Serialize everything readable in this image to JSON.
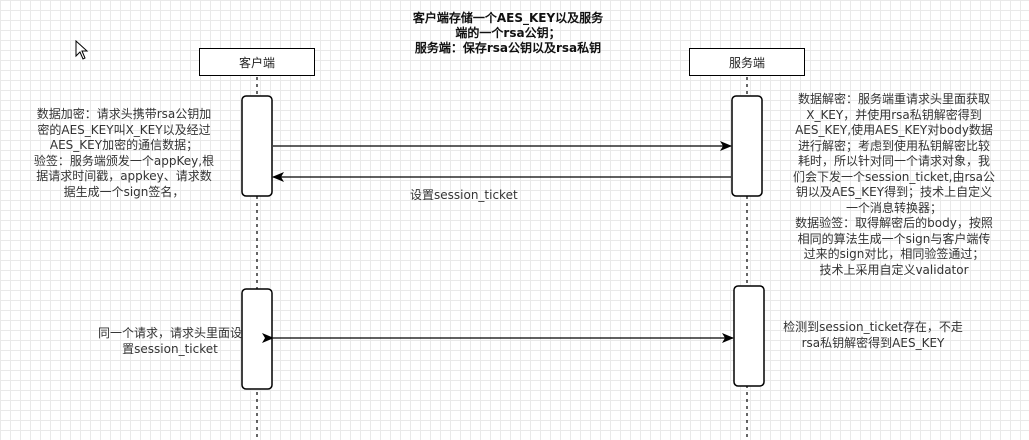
{
  "diagram": {
    "title": "客户端存储一个AES_KEY以及服务端的一个rsa公钥；\n服务端：保存rsa公钥以及rsa私钥",
    "participants": {
      "client": "客户端",
      "server": "服务端"
    },
    "notes": {
      "client_first": "数据加密：请求头携带rsa公钥加\n密的AES_KEY叫X_KEY以及经过\nAES_KEY加密的通信数据；\n验签：服务端颁发一个appKey,根\n据请求时间戳，appkey、请求数\n据生成一个sign签名，",
      "server_first": "数据解密：服务端重请求头里面获取\nX_KEY，并使用rsa私钥解密得到\nAES_KEY,使用AES_KEY对body数据\n进行解密；考虑到使用私钥解密比较\n耗时，所以针对同一个请求对象，我\n们会下发一个session_ticket,由rsa公\n钥以及AES_KEY得到；技术上自定义\n一个消息转换器；\n数据验签：取得解密后的body，按照\n相同的算法生成一个sign与客户端传\n过来的sign对比，相同验签通过；\n技术上采用自定义validator",
      "client_second": "同一个请求，请求头里面设\n置session_ticket",
      "server_second": "检测到session_ticket存在，不走\nrsa私钥解密得到AES_KEY"
    },
    "messages": {
      "return_label": "设置session_ticket"
    },
    "colors": {
      "line": "#000000",
      "text": "#333333",
      "grid": "#e9e9e9"
    }
  }
}
